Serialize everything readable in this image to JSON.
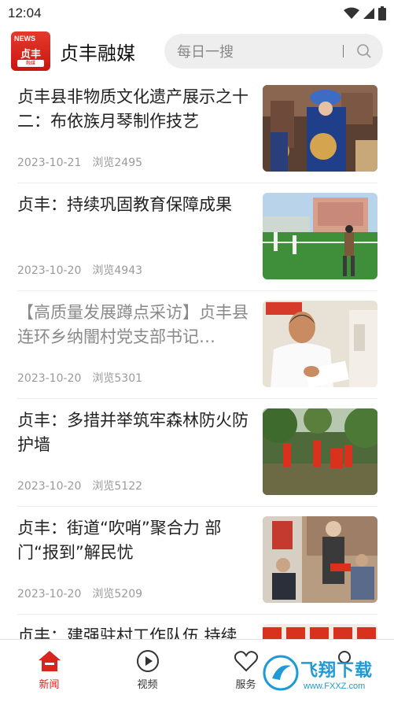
{
  "status_bar": {
    "time": "12:04"
  },
  "header": {
    "logo_news": "NEWS",
    "logo_main": "贞丰",
    "logo_sub": "融媒",
    "title": "贞丰融媒",
    "search_placeholder": "每日一搜"
  },
  "news": [
    {
      "title": "贞丰县非物质文化遗产展示之十二：布依族月琴制作技艺",
      "date": "2023-10-21",
      "views": "浏览2495",
      "read": false
    },
    {
      "title": "贞丰：持续巩固教育保障成果",
      "date": "2023-10-20",
      "views": "浏览4943",
      "read": false
    },
    {
      "title": "【高质量发展蹲点采访】贞丰县连环乡纳闇村党支部书记…",
      "date": "2023-10-20",
      "views": "浏览5301",
      "read": true
    },
    {
      "title": "贞丰：多措并举筑牢森林防火防护墙",
      "date": "2023-10-20",
      "views": "浏览5122",
      "read": false
    },
    {
      "title": "贞丰：街道“吹哨”聚合力 部门“报到”解民忧",
      "date": "2023-10-20",
      "views": "浏览5209",
      "read": false
    },
    {
      "title": "贞丰：建强驻村工作队伍 持续",
      "date": "",
      "views": "",
      "read": false
    }
  ],
  "nav": [
    {
      "label": "新闻",
      "icon": "home-icon",
      "active": true
    },
    {
      "label": "视频",
      "icon": "play-icon",
      "active": false
    },
    {
      "label": "服务",
      "icon": "heart-icon",
      "active": false
    },
    {
      "label": "",
      "icon": "user-icon",
      "active": false
    }
  ],
  "watermark": {
    "text": "飞翔下载",
    "url": "www.FXXZ.com"
  },
  "colors": {
    "accent": "#d9251d",
    "watermark": "#1f9ad6"
  }
}
